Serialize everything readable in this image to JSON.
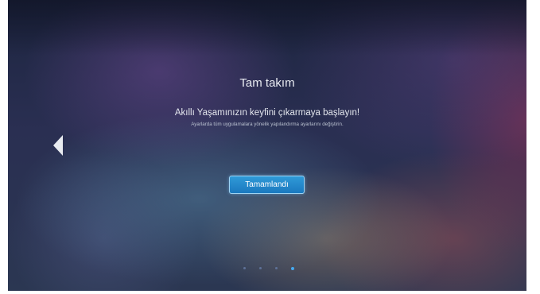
{
  "setup": {
    "title": "Tam takım",
    "headline": "Akıllı Yaşamınızın keyfini çıkarmaya başlayın!",
    "subtitle": "Ayarlarda tüm uygulamalara yönelik yapılandırma ayarlarını değiştirin.",
    "done_button_label": "Tamamlandı"
  },
  "navigation": {
    "prev_icon": "chevron-left-icon"
  },
  "pagination": {
    "total_pages": 4,
    "current_page": 4
  },
  "colors": {
    "accent": "#1f86cb",
    "accent_border": "#9fd3f3",
    "active_dot": "#45a9ef",
    "inactive_dot": "#5e7197"
  }
}
